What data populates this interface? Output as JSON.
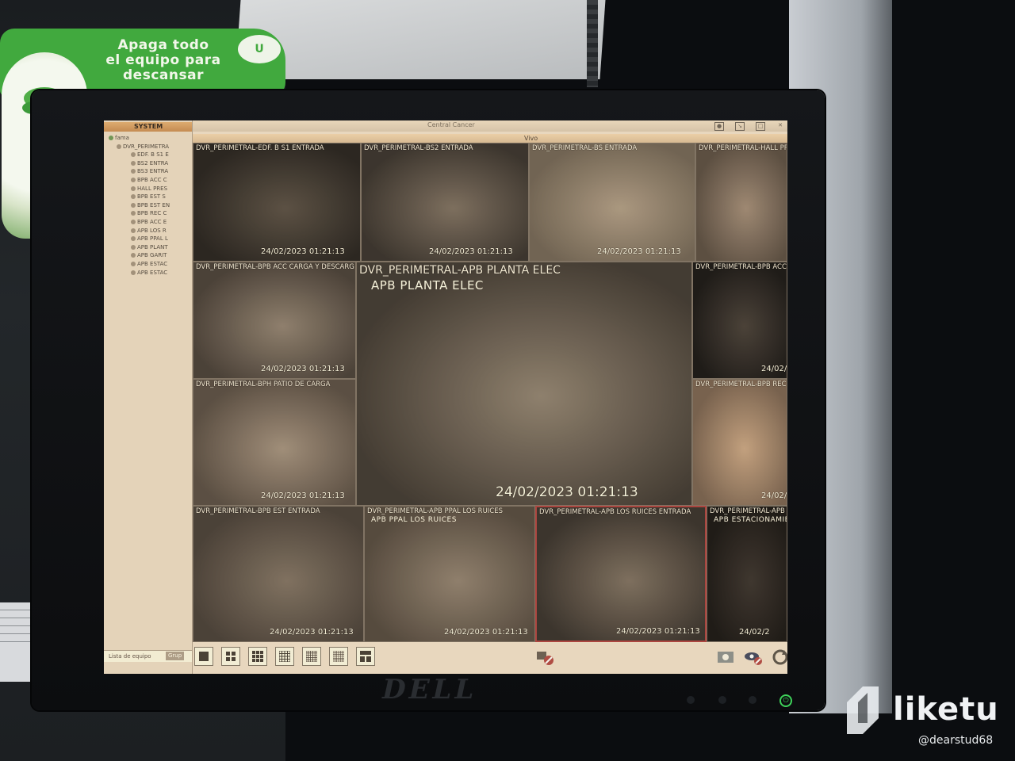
{
  "sticker": {
    "lines": [
      "Apaga todo",
      "el equipo para",
      "descansar"
    ],
    "logo": "U"
  },
  "monitor": {
    "brand": "DELL"
  },
  "app": {
    "window_title": "Central Cancer",
    "system_label": "SYSTEM",
    "live_label": "Vivo",
    "tree": [
      "fama",
      "DVR_PERIMETRA",
      "EDF. B S1 E",
      "BS2 ENTRA",
      "BS3 ENTRA",
      "BPB ACC C",
      "HALL PRES",
      "BPB EST S",
      "BPB EST EN",
      "BPB REC C",
      "BPB ACC E",
      "APB LOS R",
      "APB PPAL L",
      "APB PLANT",
      "APB GARIT",
      "APB ESTAC",
      "APB ESTAC"
    ],
    "sidebar_tab_list": "Lista de equipo",
    "sidebar_tab_group": "Grup"
  },
  "cameras": [
    {
      "id": "c1",
      "label": "DVR_PERIMETRAL-EDF. B S1 ENTRADA",
      "ts": "24/02/2023 01:21:13"
    },
    {
      "id": "c2",
      "label": "DVR_PERIMETRAL-BS2 ENTRADA",
      "ts": "24/02/2023 01:21:13"
    },
    {
      "id": "c3",
      "label": "DVR_PERIMETRAL-BS ENTRADA",
      "ts": "24/02/2023 01:21:13"
    },
    {
      "id": "c4",
      "label": "DVR_PERIMETRAL-HALL PR",
      "ts": ""
    },
    {
      "id": "c5",
      "label": "DVR_PERIMETRAL-BPB ACC CARGA Y DESCARG",
      "ts": "24/02/2023 01:21:13"
    },
    {
      "id": "c6",
      "label": "DVR_PERIMETRAL-APB PLANTA ELEC",
      "sub": "APB PLANTA ELEC",
      "ts": "24/02/2023 01:21:13"
    },
    {
      "id": "c7",
      "label": "DVR_PERIMETRAL-BPB ACC",
      "ts": "24/02/2"
    },
    {
      "id": "c8",
      "label": "DVR_PERIMETRAL-BPH PATIO DE CARGA",
      "ts": "24/02/2023 01:21:13"
    },
    {
      "id": "c9",
      "label": "DVR_PERIMETRAL-BPB REC",
      "ts": "24/02/2"
    },
    {
      "id": "c10",
      "label": "DVR_PERIMETRAL-BPB EST ENTRADA",
      "ts": "24/02/2023 01:21:13"
    },
    {
      "id": "c11",
      "label": "DVR_PERIMETRAL-APB PPAL LOS RUICES",
      "sub": "APB PPAL LOS RUICES",
      "ts": "24/02/2023 01:21:13"
    },
    {
      "id": "c12",
      "label": "DVR_PERIMETRAL-APB LOS RUICES ENTRADA",
      "ts": "24/02/2023 01:21:13"
    },
    {
      "id": "c13",
      "label": "DVR_PERIMETRAL-APB ES",
      "sub": "APB ESTACIONAMIE",
      "ts": "24/02/2"
    }
  ],
  "watermark": {
    "brand": "liketu",
    "user": "@dearstud68"
  },
  "colors": {
    "sticker_green": "#41a93e",
    "selected_border": "#d03236",
    "power_led": "#3ed35a"
  }
}
